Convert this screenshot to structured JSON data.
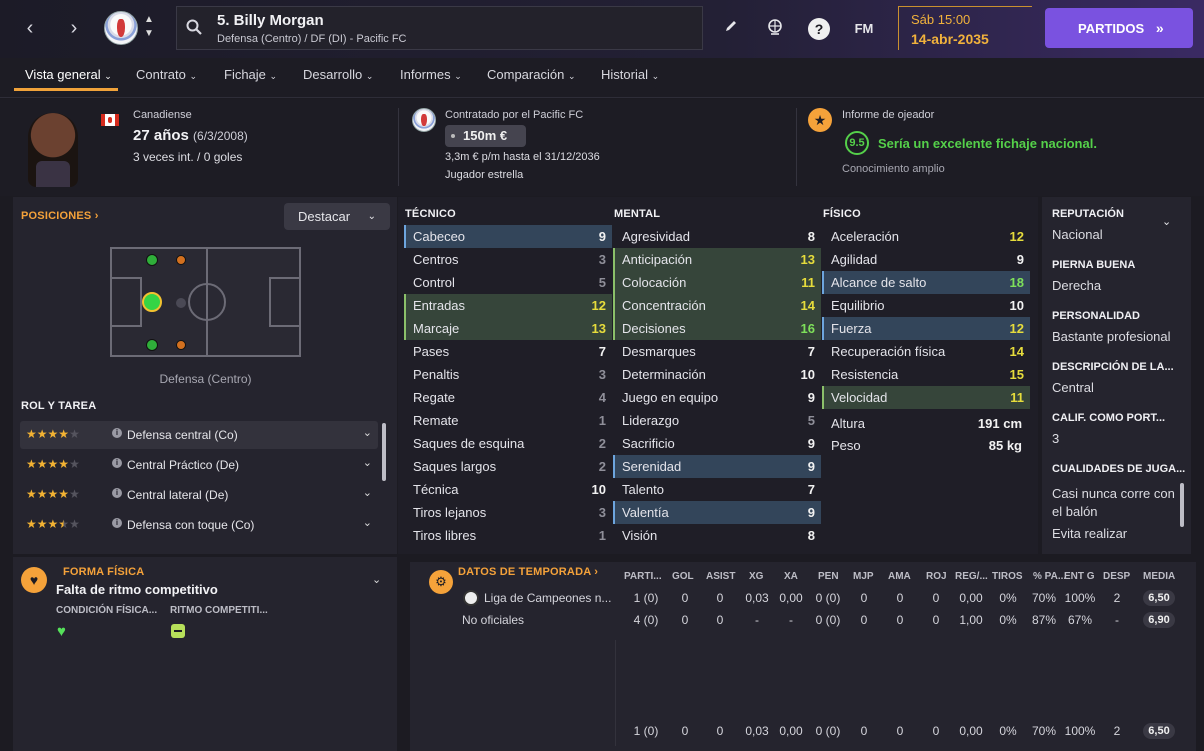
{
  "header": {
    "player_title": "5. Billy Morgan",
    "player_subtitle": "Defensa (Centro) / DF (DI) - Pacific FC",
    "logo_text": "FM",
    "date_line1": "Sáb 15:00",
    "date_line2": "14-abr-2035",
    "partidos_label": "PARTIDOS"
  },
  "tabs": [
    "Vista general",
    "Contrato",
    "Fichaje",
    "Desarrollo",
    "Informes",
    "Comparación",
    "Historial"
  ],
  "profile": {
    "nationality": "Canadiense",
    "age": "27 años",
    "dob": "(6/3/2008)",
    "caps": "3 veces int. / 0 goles",
    "contract_title": "Contratado por el Pacific FC",
    "value": "150m €",
    "wage": "3,3m € p/m hasta el 31/12/2036",
    "status": "Jugador estrella",
    "scout_title": "Informe de ojeador",
    "scout_score": "9.5",
    "scout_text": "Sería un excelente fichaje nacional.",
    "scout_knowledge": "Conocimiento amplio"
  },
  "positions": {
    "title": "POSICIONES",
    "highlight_label": "Destacar",
    "position_label": "Defensa (Centro)",
    "roles_title": "ROL Y TAREA",
    "roles": [
      {
        "stars": "★★★★★",
        "stars_full": 4,
        "name": "Defensa central (Co)"
      },
      {
        "stars": "★★★★★",
        "stars_full": 4,
        "name": "Central Práctico (De)"
      },
      {
        "stars": "★★★★★",
        "stars_full": 4,
        "name": "Central lateral (De)"
      },
      {
        "stars": "★★★★★",
        "stars_full": 3.5,
        "name": "Defensa con toque (Co)"
      }
    ]
  },
  "attributes": {
    "tecnico_title": "TÉCNICO",
    "mental_title": "MENTAL",
    "fisico_title": "FÍSICO",
    "tecnico": [
      {
        "n": "Cabeceo",
        "v": "9",
        "c": "w",
        "h": "blue"
      },
      {
        "n": "Centros",
        "v": "3",
        "c": "gr",
        "h": ""
      },
      {
        "n": "Control",
        "v": "5",
        "c": "gr",
        "h": ""
      },
      {
        "n": "Entradas",
        "v": "12",
        "c": "y",
        "h": "green"
      },
      {
        "n": "Marcaje",
        "v": "13",
        "c": "y",
        "h": "green"
      },
      {
        "n": "Pases",
        "v": "7",
        "c": "w",
        "h": ""
      },
      {
        "n": "Penaltis",
        "v": "3",
        "c": "gr",
        "h": ""
      },
      {
        "n": "Regate",
        "v": "4",
        "c": "gr",
        "h": ""
      },
      {
        "n": "Remate",
        "v": "1",
        "c": "gr",
        "h": ""
      },
      {
        "n": "Saques de esquina",
        "v": "2",
        "c": "gr",
        "h": ""
      },
      {
        "n": "Saques largos",
        "v": "2",
        "c": "gr",
        "h": ""
      },
      {
        "n": "Técnica",
        "v": "10",
        "c": "w",
        "h": ""
      },
      {
        "n": "Tiros lejanos",
        "v": "3",
        "c": "gr",
        "h": ""
      },
      {
        "n": "Tiros libres",
        "v": "1",
        "c": "gr",
        "h": ""
      }
    ],
    "mental": [
      {
        "n": "Agresividad",
        "v": "8",
        "c": "w",
        "h": ""
      },
      {
        "n": "Anticipación",
        "v": "13",
        "c": "y",
        "h": "green"
      },
      {
        "n": "Colocación",
        "v": "11",
        "c": "y",
        "h": "green"
      },
      {
        "n": "Concentración",
        "v": "14",
        "c": "y",
        "h": "green"
      },
      {
        "n": "Decisiones",
        "v": "16",
        "c": "g",
        "h": "green"
      },
      {
        "n": "Desmarques",
        "v": "7",
        "c": "w",
        "h": ""
      },
      {
        "n": "Determinación",
        "v": "10",
        "c": "w",
        "h": ""
      },
      {
        "n": "Juego en equipo",
        "v": "9",
        "c": "w",
        "h": ""
      },
      {
        "n": "Liderazgo",
        "v": "5",
        "c": "gr",
        "h": ""
      },
      {
        "n": "Sacrificio",
        "v": "9",
        "c": "w",
        "h": ""
      },
      {
        "n": "Serenidad",
        "v": "9",
        "c": "w",
        "h": "blue"
      },
      {
        "n": "Talento",
        "v": "7",
        "c": "w",
        "h": ""
      },
      {
        "n": "Valentía",
        "v": "9",
        "c": "w",
        "h": "blue"
      },
      {
        "n": "Visión",
        "v": "8",
        "c": "w",
        "h": ""
      }
    ],
    "fisico": [
      {
        "n": "Aceleración",
        "v": "12",
        "c": "y",
        "h": ""
      },
      {
        "n": "Agilidad",
        "v": "9",
        "c": "w",
        "h": ""
      },
      {
        "n": "Alcance de salto",
        "v": "18",
        "c": "g",
        "h": "blue"
      },
      {
        "n": "Equilibrio",
        "v": "10",
        "c": "w",
        "h": ""
      },
      {
        "n": "Fuerza",
        "v": "12",
        "c": "y",
        "h": "blue"
      },
      {
        "n": "Recuperación física",
        "v": "14",
        "c": "y",
        "h": ""
      },
      {
        "n": "Resistencia",
        "v": "15",
        "c": "y",
        "h": ""
      },
      {
        "n": "Velocidad",
        "v": "11",
        "c": "y",
        "h": "green"
      }
    ],
    "altura_label": "Altura",
    "altura": "191 cm",
    "peso_label": "Peso",
    "peso": "85 kg"
  },
  "info": {
    "reputacion_h": "REPUTACIÓN",
    "reputacion": "Nacional",
    "pierna_h": "PIERNA BUENA",
    "pierna": "Derecha",
    "personalidad_h": "PERSONALIDAD",
    "personalidad": "Bastante profesional",
    "descripcion_h": "DESCRIPCIÓN DE LA...",
    "descripcion": "Central",
    "calif_h": "CALIF. COMO PORT...",
    "calif": "3",
    "cualidades_h": "CUALIDADES DE JUGA...",
    "cualidad1a": "Casi nunca corre con",
    "cualidad1b": "el balón",
    "cualidad2": "Evita realizar"
  },
  "fitness": {
    "title": "FORMA FÍSICA",
    "status": "Falta de ritmo competitivo",
    "cond_label": "CONDICIÓN FÍSICA...",
    "ritmo_label": "RITMO COMPETITI..."
  },
  "season": {
    "title": "DATOS DE TEMPORADA",
    "headers": [
      "PARTI...",
      "GOL",
      "ASIST",
      "XG",
      "XA",
      "PEN",
      "MJP",
      "AMA",
      "ROJ",
      "REG/...",
      "TIROS",
      "% PA...",
      "ENT G",
      "DESP",
      "MEDIA"
    ],
    "rows": [
      {
        "name": "Liga de Campeones n...",
        "vals": [
          "1 (0)",
          "0",
          "0",
          "0,03",
          "0,00",
          "0 (0)",
          "0",
          "0",
          "0",
          "0,00",
          "0%",
          "70%",
          "100%",
          "2"
        ],
        "media": "6,50"
      },
      {
        "name": "No oficiales",
        "vals": [
          "4 (0)",
          "0",
          "0",
          "-",
          "-",
          "0 (0)",
          "0",
          "0",
          "0",
          "1,00",
          "0%",
          "87%",
          "67%",
          "-"
        ],
        "media": "6,90"
      }
    ],
    "total": {
      "vals": [
        "1 (0)",
        "0",
        "0",
        "0,03",
        "0,00",
        "0 (0)",
        "0",
        "0",
        "0",
        "0,00",
        "0%",
        "70%",
        "100%",
        "2"
      ],
      "media": "6,50"
    }
  }
}
